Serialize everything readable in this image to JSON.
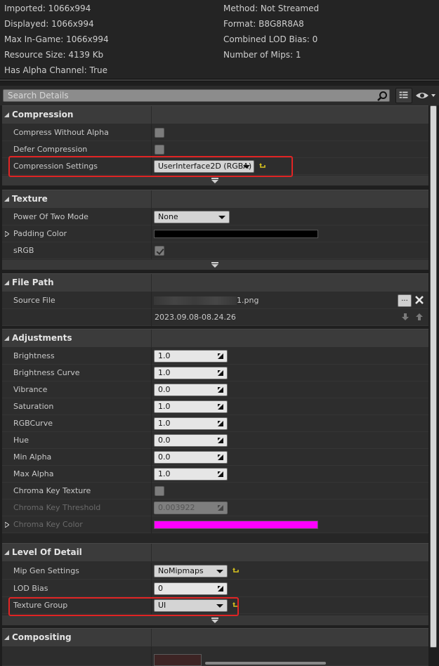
{
  "texture_info": {
    "left": [
      "Imported: 1066x994",
      "Displayed: 1066x994",
      "Max In-Game: 1066x994",
      "Resource Size: 4139 Kb",
      "Has Alpha Channel: True"
    ],
    "right": [
      "Method: Not Streamed",
      "Format: B8G8R8A8",
      "Combined LOD Bias: 0",
      "Number of Mips: 1"
    ]
  },
  "search": {
    "placeholder": "Search Details"
  },
  "colors": {
    "accent_red": "#e02424",
    "reset_arrow": "#d6c21f",
    "padding_color": "#000000",
    "chroma_key_color": "#ff00ff"
  },
  "icons": {
    "search": "search-icon",
    "view_options": "grid-icon",
    "visibility": "eye-icon",
    "reset": "reset-to-default-icon",
    "browse": "browse-icon",
    "clear": "close-icon"
  },
  "sections": {
    "compression": {
      "title": "Compression",
      "compress_without_alpha": {
        "label": "Compress Without Alpha",
        "checked": false
      },
      "defer_compression": {
        "label": "Defer Compression",
        "checked": false
      },
      "compression_settings": {
        "label": "Compression Settings",
        "value": "UserInterface2D (RGBA)"
      }
    },
    "texture": {
      "title": "Texture",
      "power_of_two": {
        "label": "Power Of Two Mode",
        "value": "None"
      },
      "padding_color": {
        "label": "Padding Color"
      },
      "srgb": {
        "label": "sRGB",
        "checked": true
      }
    },
    "file_path": {
      "title": "File Path",
      "source_file": {
        "label": "Source File",
        "value": "1.png",
        "timestamp": "2023.09.08-08.24.26",
        "browse_label": "..."
      }
    },
    "adjustments": {
      "title": "Adjustments",
      "brightness": {
        "label": "Brightness",
        "value": "1.0"
      },
      "brightness_curve": {
        "label": "Brightness Curve",
        "value": "1.0"
      },
      "vibrance": {
        "label": "Vibrance",
        "value": "0.0"
      },
      "saturation": {
        "label": "Saturation",
        "value": "1.0"
      },
      "rgbcurve": {
        "label": "RGBCurve",
        "value": "1.0"
      },
      "hue": {
        "label": "Hue",
        "value": "0.0"
      },
      "min_alpha": {
        "label": "Min Alpha",
        "value": "0.0"
      },
      "max_alpha": {
        "label": "Max Alpha",
        "value": "1.0"
      },
      "chroma_key_texture": {
        "label": "Chroma Key Texture",
        "checked": false
      },
      "chroma_key_threshold": {
        "label": "Chroma Key Threshold",
        "value": "0.003922"
      },
      "chroma_key_color": {
        "label": "Chroma Key Color"
      }
    },
    "lod": {
      "title": "Level Of Detail",
      "mip_gen": {
        "label": "Mip Gen Settings",
        "value": "NoMipmaps"
      },
      "lod_bias": {
        "label": "LOD Bias",
        "value": "0"
      },
      "texture_group": {
        "label": "Texture Group",
        "value": "UI"
      }
    },
    "compositing": {
      "title": "Compositing"
    }
  }
}
